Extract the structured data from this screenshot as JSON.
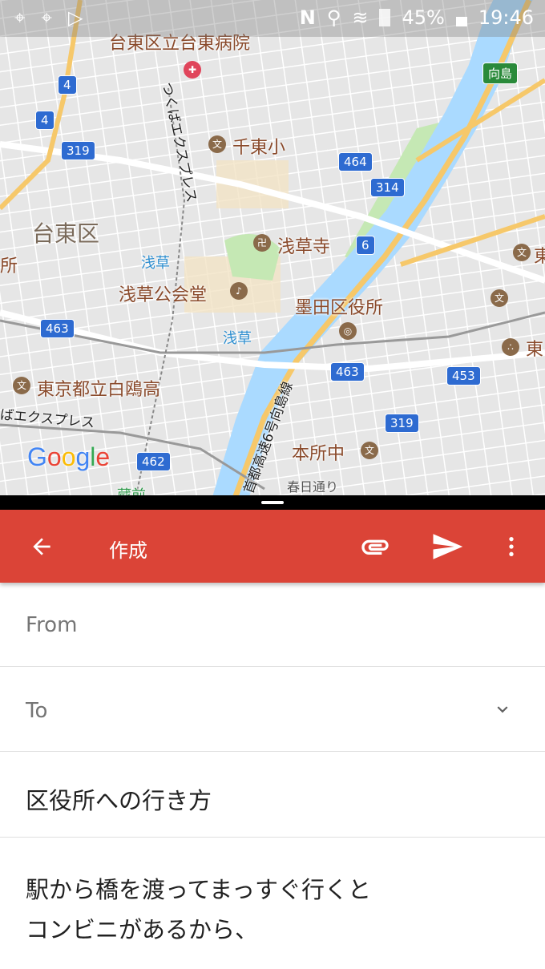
{
  "status_bar": {
    "battery": "45%",
    "time": "19:46",
    "icons": [
      "maps-icon",
      "maps-icon",
      "play-store-icon",
      "nfc-icon",
      "location-icon",
      "wifi-icon",
      "sim-unknown-icon",
      "battery-icon"
    ]
  },
  "map": {
    "logo": "Google",
    "labels": [
      "台東区立台東病院",
      "千東小",
      "台東区",
      "浅草寺",
      "浅草",
      "浅草公会堂",
      "墨田区役所",
      "浅草",
      "東京都立白鴎高",
      "本所中",
      "春日通り",
      "つくばエクスプレス",
      "ばエクスプレス",
      "首都高速6号向島線",
      "向島",
      "所",
      "東",
      "東",
      "蔵前"
    ],
    "shields": [
      "4",
      "4",
      "319",
      "464",
      "314",
      "6",
      "463",
      "463",
      "453",
      "319",
      "462"
    ],
    "colors": {
      "river": "#aadaff",
      "highway": "#f6c86a",
      "land": "#e8e8e8",
      "park": "#c5e8b4"
    }
  },
  "compose": {
    "toolbar": {
      "title": "作成",
      "back": "arrow-back-icon",
      "attach": "attach-icon",
      "send": "send-icon",
      "more": "more-vert-icon",
      "color": "#db4437"
    },
    "from_label": "From",
    "to_label": "To",
    "subject": "区役所への行き方",
    "body_lines": [
      "駅から橋を渡ってまっすぐ行くと",
      "コンビニがあるから、"
    ]
  }
}
